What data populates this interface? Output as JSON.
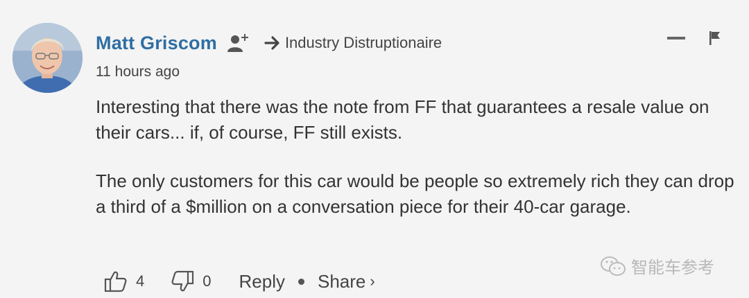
{
  "comment": {
    "author": "Matt Griscom",
    "replying_to": "Industry Distruptionaire",
    "time": "11 hours ago",
    "paragraphs": [
      "Interesting that there was the note from FF that guarantees a resale value on their cars... if, of course, FF still exists.",
      "The only customers for this car would be people so extremely rich they can drop a third of a $million on a conversation piece for their 40-car garage."
    ],
    "upvotes": "4",
    "downvotes": "0",
    "reply_label": "Reply",
    "share_label": "Share",
    "share_chevron": "›"
  },
  "icons": {
    "follow": "add-user-icon",
    "reply_arrow": "arrow-right-icon",
    "collapse": "minus-icon",
    "flag": "flag-icon",
    "upvote": "thumbs-up-icon",
    "downvote": "thumbs-down-icon"
  },
  "watermark": {
    "text": "智能车参考"
  },
  "colors": {
    "author": "#2f6ea3",
    "text": "#333333",
    "background": "#f4f4f4"
  }
}
